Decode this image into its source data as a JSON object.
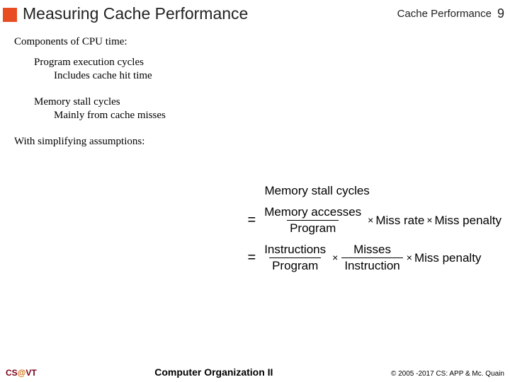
{
  "header": {
    "title": "Measuring Cache Performance",
    "section": "Cache Performance",
    "page": "9"
  },
  "body": {
    "components": "Components of CPU time:",
    "prog_exec": "Program execution cycles",
    "prog_exec_sub": "Includes cache hit time",
    "mem_stall": "Memory stall cycles",
    "mem_stall_sub": "Mainly from cache misses",
    "assumptions": "With simplifying assumptions:"
  },
  "eq": {
    "lhs": "Memory stall cycles",
    "eq": "=",
    "mem_acc": "Memory accesses",
    "program": "Program",
    "miss_rate": "Miss rate",
    "miss_penalty": "Miss penalty",
    "instructions": "Instructions",
    "misses": "Misses",
    "instruction": "Instruction",
    "times": "×"
  },
  "footer": {
    "left_a": "CS",
    "left_b": "@",
    "left_c": "VT",
    "center": "Computer Organization II",
    "right": "© 2005 -2017 CS: APP & Mc. Quain"
  }
}
